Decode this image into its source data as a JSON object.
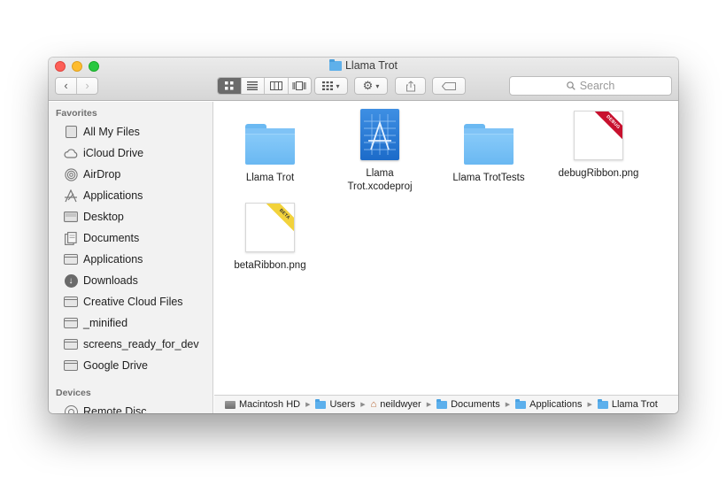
{
  "window": {
    "title": "Llama Trot"
  },
  "toolbar": {
    "back_glyph": "‹",
    "forward_glyph": "›",
    "view_buttons": [
      "icon-view",
      "list-view",
      "column-view",
      "coverflow-view"
    ],
    "search_placeholder": "Search"
  },
  "sidebar": {
    "favorites_header": "Favorites",
    "favorites": [
      {
        "label": "All My Files",
        "icon": "all-files-icon"
      },
      {
        "label": "iCloud Drive",
        "icon": "cloud-icon"
      },
      {
        "label": "AirDrop",
        "icon": "airdrop-icon"
      },
      {
        "label": "Applications",
        "icon": "applications-icon"
      },
      {
        "label": "Desktop",
        "icon": "desktop-icon"
      },
      {
        "label": "Documents",
        "icon": "documents-icon"
      },
      {
        "label": "Applications",
        "icon": "folder-icon"
      },
      {
        "label": "Downloads",
        "icon": "download-icon"
      },
      {
        "label": "Creative Cloud Files",
        "icon": "folder-icon"
      },
      {
        "label": "_minified",
        "icon": "folder-icon"
      },
      {
        "label": "screens_ready_for_dev",
        "icon": "folder-icon"
      },
      {
        "label": "Google Drive",
        "icon": "folder-icon"
      }
    ],
    "devices_header": "Devices",
    "devices": [
      {
        "label": "Remote Disc",
        "icon": "disc-icon"
      }
    ]
  },
  "files": [
    {
      "name": "Llama Trot",
      "kind": "folder"
    },
    {
      "name": "Llama Trot.xcodeproj",
      "kind": "xcodeproj"
    },
    {
      "name": "Llama TrotTests",
      "kind": "folder"
    },
    {
      "name": "debugRibbon.png",
      "kind": "png",
      "ribbon_color": "#c8102e",
      "ribbon_text": "DEBUG"
    },
    {
      "name": "betaRibbon.png",
      "kind": "png",
      "ribbon_color": "#f2d23b",
      "ribbon_text": "BETA"
    }
  ],
  "pathbar": [
    {
      "label": "Macintosh HD",
      "icon": "disk-icon"
    },
    {
      "label": "Users",
      "icon": "folder-icon"
    },
    {
      "label": "neildwyer",
      "icon": "home-icon"
    },
    {
      "label": "Documents",
      "icon": "folder-icon"
    },
    {
      "label": "Applications",
      "icon": "folder-icon"
    },
    {
      "label": "Llama Trot",
      "icon": "folder-icon"
    }
  ],
  "colors": {
    "folder_blue": "#6ab8f2",
    "xcode_blue": "#2a7bd6",
    "close": "#fd5f57",
    "minimize": "#febc2e",
    "zoom": "#28c840"
  }
}
